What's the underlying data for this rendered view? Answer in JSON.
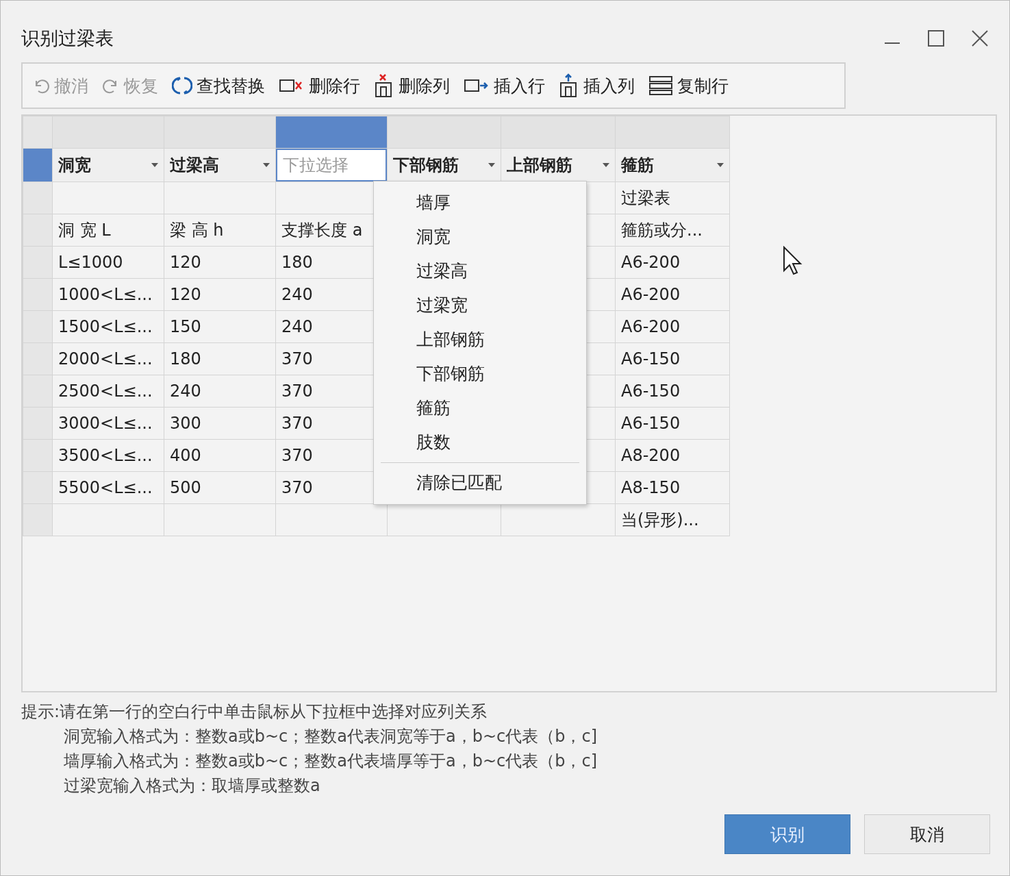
{
  "window": {
    "title": "识别过梁表"
  },
  "toolbar": [
    {
      "label": "撤消",
      "kind": "undo",
      "disabled": true
    },
    {
      "label": "恢复",
      "kind": "redo",
      "disabled": true
    },
    {
      "label": "查找替换",
      "kind": "find-replace",
      "disabled": false
    },
    {
      "label": "删除行",
      "kind": "delete-row",
      "disabled": false
    },
    {
      "label": "删除列",
      "kind": "delete-column",
      "disabled": false
    },
    {
      "label": "插入行",
      "kind": "insert-row",
      "disabled": false
    },
    {
      "label": "插入列",
      "kind": "insert-column",
      "disabled": false
    },
    {
      "label": "复制行",
      "kind": "copy-row",
      "disabled": false
    }
  ],
  "table": {
    "columns": [
      {
        "label": "洞宽",
        "selected": false
      },
      {
        "label": "过梁高",
        "selected": false
      },
      {
        "placeholder": "下拉选择",
        "selected": true
      },
      {
        "label": "下部钢筋",
        "selected": false
      },
      {
        "label": "上部钢筋",
        "selected": false
      },
      {
        "label": "箍筋",
        "selected": false
      }
    ],
    "rows": [
      {
        "cells": [
          null,
          null,
          null,
          null,
          null,
          "过梁表"
        ]
      },
      {
        "cells": [
          "洞 宽 L",
          "梁 高 h",
          "支撑长度 a",
          null,
          null,
          "箍筋或分..."
        ]
      },
      {
        "cells": [
          "L≤1000",
          "120",
          "180",
          null,
          null,
          "A6-200"
        ]
      },
      {
        "cells": [
          "1000<L≤...",
          "120",
          "240",
          null,
          null,
          "A6-200"
        ]
      },
      {
        "cells": [
          "1500<L≤...",
          "150",
          "240",
          null,
          null,
          "A6-200"
        ]
      },
      {
        "cells": [
          "2000<L≤...",
          "180",
          "370",
          null,
          null,
          "A6-150"
        ]
      },
      {
        "cells": [
          "2500<L≤...",
          "240",
          "370",
          null,
          null,
          "A6-150"
        ]
      },
      {
        "cells": [
          "3000<L≤...",
          "300",
          "370",
          null,
          null,
          "A6-150"
        ]
      },
      {
        "cells": [
          "3500<L≤...",
          "400",
          "370",
          null,
          null,
          "A8-200"
        ]
      },
      {
        "cells": [
          "5500<L≤...",
          "500",
          "370",
          null,
          null,
          "A8-150"
        ]
      },
      {
        "cells": [
          null,
          null,
          null,
          null,
          null,
          "当(异形)..."
        ]
      }
    ]
  },
  "dropdown_menu": [
    {
      "label": "墙厚",
      "kind": "option"
    },
    {
      "label": "洞宽",
      "kind": "option"
    },
    {
      "label": "过梁高",
      "kind": "option"
    },
    {
      "label": "过梁宽",
      "kind": "option"
    },
    {
      "label": "上部钢筋",
      "kind": "option"
    },
    {
      "label": "下部钢筋",
      "kind": "option"
    },
    {
      "label": "箍筋",
      "kind": "option"
    },
    {
      "label": "肢数",
      "kind": "option"
    },
    {
      "label": "清除已匹配",
      "kind": "action"
    }
  ],
  "hint": {
    "title": "提示:请在第一行的空白行中单击鼠标从下拉框中选择对应列关系",
    "lines": [
      "洞宽输入格式为：整数a或b~c；整数a代表洞宽等于a，b~c代表（b，c]",
      "墙厚输入格式为：整数a或b~c；整数a代表墙厚等于a，b~c代表（b，c]",
      "过梁宽输入格式为：取墙厚或整数a"
    ]
  },
  "buttons": [
    {
      "label": "识别",
      "primary": true
    },
    {
      "label": "取消",
      "primary": false
    }
  ]
}
